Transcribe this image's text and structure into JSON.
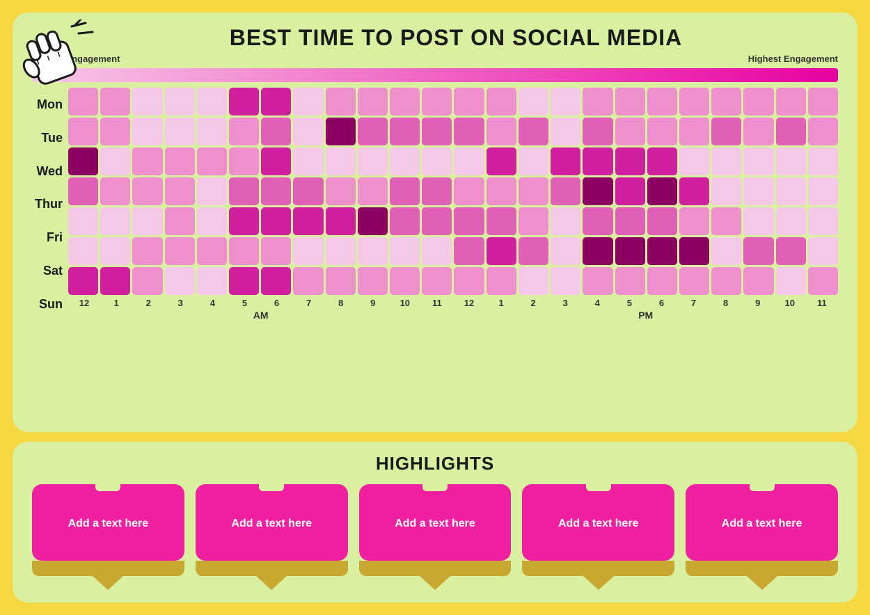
{
  "page": {
    "background_color": "#f5d842"
  },
  "top_card": {
    "title": "BEST TIME TO POST ON SOCIAL MEDIA",
    "legend": {
      "lowest": "Lowest Engagement",
      "highest": "Highest Engagement"
    },
    "days": [
      "Mon",
      "Tue",
      "Wed",
      "Thur",
      "Fri",
      "Sat",
      "Sun"
    ],
    "hours": [
      "12",
      "1",
      "2",
      "3",
      "4",
      "5",
      "6",
      "7",
      "8",
      "9",
      "10",
      "11",
      "12",
      "1",
      "2",
      "3",
      "4",
      "5",
      "6",
      "7",
      "8",
      "9",
      "10",
      "11"
    ],
    "am_label": "AM",
    "pm_label": "PM",
    "heatmap": [
      [
        2,
        2,
        1,
        1,
        1,
        4,
        4,
        1,
        2,
        2,
        2,
        2,
        2,
        2,
        1,
        1,
        2,
        2,
        2,
        2,
        2,
        2,
        2,
        2
      ],
      [
        2,
        2,
        1,
        1,
        1,
        2,
        3,
        1,
        5,
        3,
        3,
        3,
        3,
        2,
        3,
        1,
        3,
        2,
        2,
        2,
        3,
        2,
        3,
        2
      ],
      [
        5,
        1,
        2,
        2,
        2,
        2,
        4,
        1,
        1,
        1,
        1,
        1,
        1,
        4,
        1,
        4,
        4,
        4,
        4,
        1,
        1,
        1,
        1,
        1
      ],
      [
        3,
        2,
        2,
        2,
        1,
        3,
        3,
        3,
        2,
        2,
        3,
        3,
        2,
        2,
        2,
        3,
        5,
        4,
        5,
        4,
        1,
        1,
        1,
        1
      ],
      [
        1,
        1,
        1,
        2,
        1,
        4,
        4,
        4,
        4,
        5,
        3,
        3,
        3,
        3,
        2,
        1,
        3,
        3,
        3,
        2,
        2,
        1,
        1,
        1
      ],
      [
        1,
        1,
        2,
        2,
        2,
        2,
        2,
        1,
        1,
        1,
        1,
        1,
        3,
        4,
        3,
        1,
        5,
        5,
        5,
        5,
        1,
        3,
        3,
        1
      ],
      [
        4,
        4,
        2,
        1,
        1,
        4,
        4,
        2,
        2,
        2,
        2,
        2,
        2,
        2,
        1,
        1,
        2,
        2,
        2,
        2,
        2,
        2,
        1,
        2
      ]
    ]
  },
  "bottom_card": {
    "title": "HIGHLIGHTS",
    "cards": [
      {
        "text": "Add a text here"
      },
      {
        "text": "Add a text here"
      },
      {
        "text": "Add a text here"
      },
      {
        "text": "Add a text here"
      },
      {
        "text": "Add a text here"
      }
    ]
  }
}
